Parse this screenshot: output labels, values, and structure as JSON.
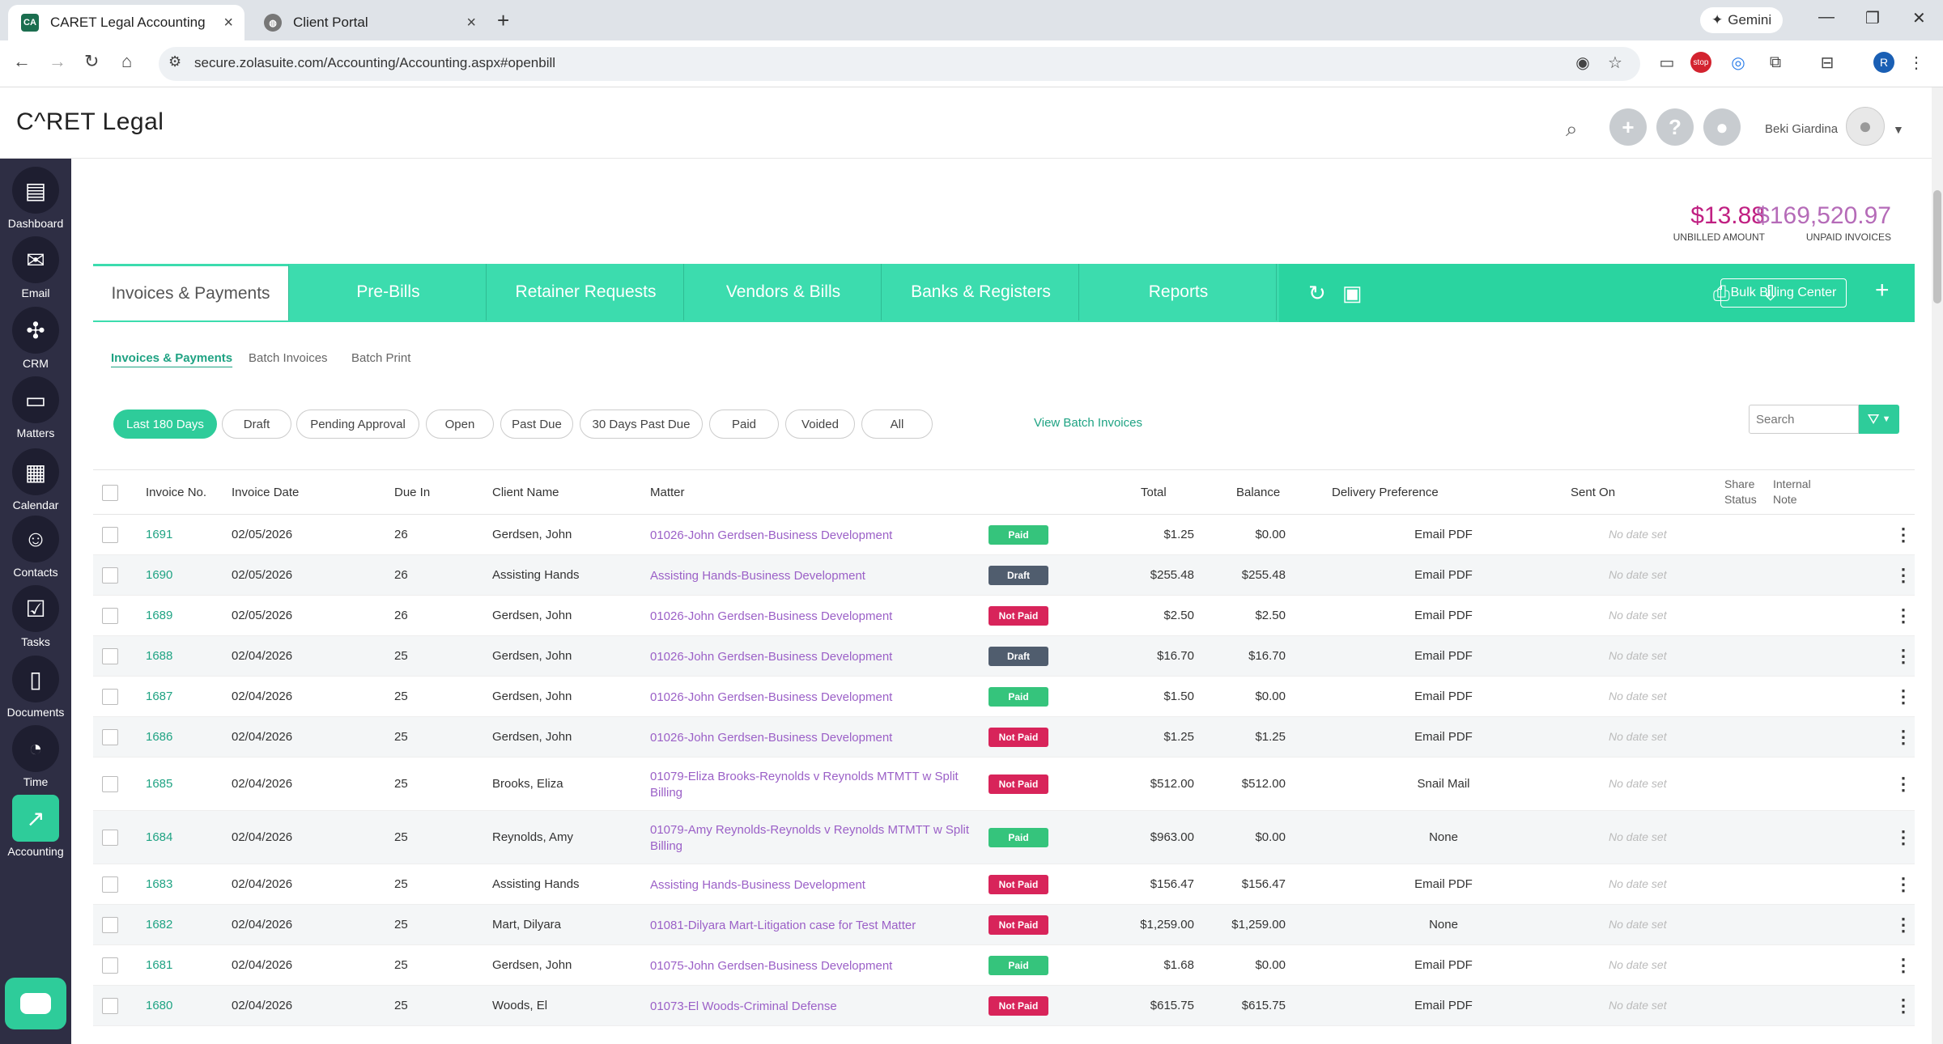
{
  "browser": {
    "tabs": [
      {
        "label": "CARET Legal Accounting",
        "favicon": "CA",
        "active": true
      },
      {
        "label": "Client Portal",
        "favicon": "globe",
        "active": false
      }
    ],
    "url": "secure.zolasuite.com/Accounting/Accounting.aspx#openbill",
    "gemini_label": "Gemini",
    "profile_initial": "R"
  },
  "header": {
    "logo": "C^RET Legal",
    "user_name": "Beki Giardina"
  },
  "sidebar": {
    "items": [
      {
        "label": "Dashboard",
        "icon": "dashboard-icon"
      },
      {
        "label": "Email",
        "icon": "envelope-icon"
      },
      {
        "label": "CRM",
        "icon": "network-icon"
      },
      {
        "label": "Matters",
        "icon": "briefcase-icon"
      },
      {
        "label": "Calendar",
        "icon": "calendar-icon"
      },
      {
        "label": "Contacts",
        "icon": "person-icon"
      },
      {
        "label": "Tasks",
        "icon": "checkbox-icon"
      },
      {
        "label": "Documents",
        "icon": "document-icon"
      },
      {
        "label": "Time",
        "icon": "stopwatch-icon"
      },
      {
        "label": "Accounting",
        "icon": "chart-icon"
      }
    ]
  },
  "summary": {
    "unbilled_value": "$13.88",
    "unbilled_label": "UNBILLED AMOUNT",
    "unpaid_value": "$169,520.97",
    "unpaid_label": "UNPAID INVOICES"
  },
  "main_tabs": [
    "Invoices & Payments",
    "Pre-Bills",
    "Retainer Requests",
    "Vendors & Bills",
    "Banks & Registers",
    "Reports"
  ],
  "toolbar": {
    "bulk_label": "Bulk Billing Center",
    "plus_label": "+"
  },
  "sub_tabs": [
    "Invoices & Payments",
    "Batch Invoices",
    "Batch Print"
  ],
  "filters": [
    "Last 180 Days",
    "Draft",
    "Pending Approval",
    "Open",
    "Past Due",
    "30 Days Past Due",
    "Paid",
    "Voided",
    "All"
  ],
  "view_batch_label": "View Batch Invoices",
  "search_placeholder": "Search",
  "columns": {
    "invoice_no": "Invoice No.",
    "invoice_date": "Invoice Date",
    "due_in": "Due In",
    "client": "Client Name",
    "matter": "Matter",
    "total": "Total",
    "balance": "Balance",
    "delivery": "Delivery Preference",
    "sent_on": "Sent On",
    "share_status_1": "Share",
    "share_status_2": "Status",
    "internal_note_1": "Internal",
    "internal_note_2": "Note"
  },
  "rows": [
    {
      "inv": "1691",
      "date": "02/05/2026",
      "due": "26",
      "client": "Gerdsen, John",
      "matter": "01026-John Gerdsen-Business Development",
      "matter2": "",
      "status": "Paid",
      "total": "$1.25",
      "balance": "$0.00",
      "delivery": "Email PDF",
      "sent": "No date set"
    },
    {
      "inv": "1690",
      "date": "02/05/2026",
      "due": "26",
      "client": "Assisting Hands",
      "matter": "Assisting Hands-Business Development",
      "matter2": "",
      "status": "Draft",
      "total": "$255.48",
      "balance": "$255.48",
      "delivery": "Email PDF",
      "sent": "No date set"
    },
    {
      "inv": "1689",
      "date": "02/05/2026",
      "due": "26",
      "client": "Gerdsen, John",
      "matter": "01026-John Gerdsen-Business Development",
      "matter2": "",
      "status": "Not Paid",
      "total": "$2.50",
      "balance": "$2.50",
      "delivery": "Email PDF",
      "sent": "No date set"
    },
    {
      "inv": "1688",
      "date": "02/04/2026",
      "due": "25",
      "client": "Gerdsen, John",
      "matter": "01026-John Gerdsen-Business Development",
      "matter2": "",
      "status": "Draft",
      "total": "$16.70",
      "balance": "$16.70",
      "delivery": "Email PDF",
      "sent": "No date set"
    },
    {
      "inv": "1687",
      "date": "02/04/2026",
      "due": "25",
      "client": "Gerdsen, John",
      "matter": "01026-John Gerdsen-Business Development",
      "matter2": "",
      "status": "Paid",
      "total": "$1.50",
      "balance": "$0.00",
      "delivery": "Email PDF",
      "sent": "No date set"
    },
    {
      "inv": "1686",
      "date": "02/04/2026",
      "due": "25",
      "client": "Gerdsen, John",
      "matter": "01026-John Gerdsen-Business Development",
      "matter2": "",
      "status": "Not Paid",
      "total": "$1.25",
      "balance": "$1.25",
      "delivery": "Email PDF",
      "sent": "No date set"
    },
    {
      "inv": "1685",
      "date": "02/04/2026",
      "due": "25",
      "client": "Brooks, Eliza",
      "matter": "01079-Eliza Brooks-Reynolds v Reynolds MTMTT w Split",
      "matter2": "Billing",
      "status": "Not Paid",
      "total": "$512.00",
      "balance": "$512.00",
      "delivery": "Snail Mail",
      "sent": "No date set"
    },
    {
      "inv": "1684",
      "date": "02/04/2026",
      "due": "25",
      "client": "Reynolds, Amy",
      "matter": "01079-Amy Reynolds-Reynolds v Reynolds MTMTT w Split",
      "matter2": "Billing",
      "status": "Paid",
      "total": "$963.00",
      "balance": "$0.00",
      "delivery": "None",
      "sent": "No date set"
    },
    {
      "inv": "1683",
      "date": "02/04/2026",
      "due": "25",
      "client": "Assisting Hands",
      "matter": "Assisting Hands-Business Development",
      "matter2": "",
      "status": "Not Paid",
      "total": "$156.47",
      "balance": "$156.47",
      "delivery": "Email PDF",
      "sent": "No date set"
    },
    {
      "inv": "1682",
      "date": "02/04/2026",
      "due": "25",
      "client": "Mart, Dilyara",
      "matter": "01081-Dilyara Mart-Litigation case for Test Matter",
      "matter2": "",
      "status": "Not Paid",
      "total": "$1,259.00",
      "balance": "$1,259.00",
      "delivery": "None",
      "sent": "No date set"
    },
    {
      "inv": "1681",
      "date": "02/04/2026",
      "due": "25",
      "client": "Gerdsen, John",
      "matter": "01075-John Gerdsen-Business Development",
      "matter2": "",
      "status": "Paid",
      "total": "$1.68",
      "balance": "$0.00",
      "delivery": "Email PDF",
      "sent": "No date set"
    },
    {
      "inv": "1680",
      "date": "02/04/2026",
      "due": "25",
      "client": "Woods, El",
      "matter": "01073-El Woods-Criminal Defense",
      "matter2": "",
      "status": "Not Paid",
      "total": "$615.75",
      "balance": "$615.75",
      "delivery": "Email PDF",
      "sent": "No date set"
    }
  ],
  "colors": {
    "accent": "#3cdcae",
    "sidebar": "#2e2e44",
    "paid": "#35c47c",
    "draft": "#505d6e",
    "not_paid": "#d8245a",
    "link": "#1fa383",
    "matter_link": "#9b60c7"
  }
}
